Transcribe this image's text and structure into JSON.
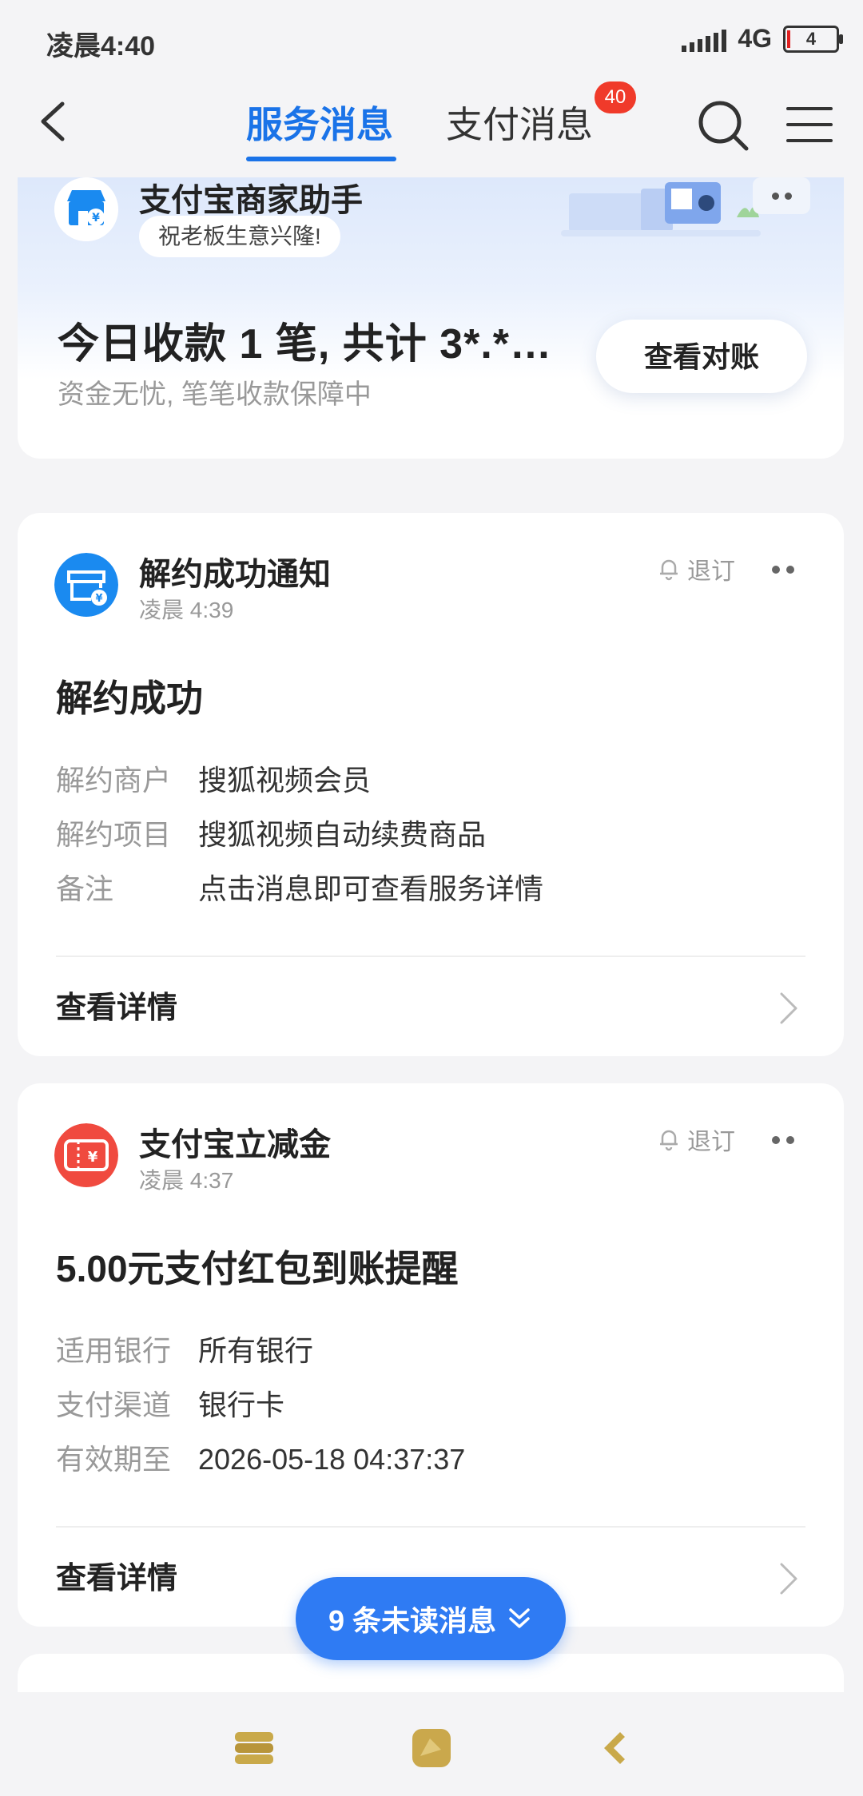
{
  "status_bar": {
    "time": "凌晨4:40",
    "network": "4G",
    "battery": "4"
  },
  "header": {
    "tabs": [
      {
        "label": "服务消息"
      },
      {
        "label": "支付消息"
      }
    ],
    "badge": "40"
  },
  "merchant": {
    "title": "支付宝商家助手",
    "greeting": "祝老板生意兴隆!",
    "summary": "今日收款 1 笔, 共计 3*.*…",
    "sub": "资金无忧, 笔笔收款保障中",
    "button": "查看对账"
  },
  "cards": [
    {
      "title": "解约成功通知",
      "time": "凌晨 4:39",
      "unsubscribe": "退订",
      "heading": "解约成功",
      "rows": [
        {
          "k": "解约商户",
          "v": "搜狐视频会员"
        },
        {
          "k": "解约项目",
          "v": "搜狐视频自动续费商品"
        },
        {
          "k": "备注",
          "v": "点击消息即可查看服务详情"
        }
      ],
      "detail": "查看详情",
      "accent": "#1a8af0"
    },
    {
      "title": "支付宝立减金",
      "time": "凌晨 4:37",
      "unsubscribe": "退订",
      "heading": "5.00元支付红包到账提醒",
      "rows": [
        {
          "k": "适用银行",
          "v": "所有银行"
        },
        {
          "k": "支付渠道",
          "v": "银行卡"
        },
        {
          "k": "有效期至",
          "v": "2026-05-18 04:37:37"
        }
      ],
      "detail": "查看详情",
      "accent": "#f04a3f"
    }
  ],
  "unread": {
    "label": "9 条未读消息"
  }
}
